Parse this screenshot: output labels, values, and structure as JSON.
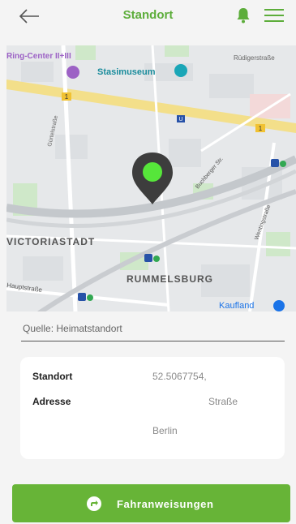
{
  "header": {
    "title": "Standort",
    "back_icon": "arrow-left-icon",
    "notification_icon": "bell-icon",
    "menu_icon": "hamburger-menu-icon",
    "accent_color": "#5cad3a"
  },
  "map": {
    "labels": {
      "ring_center": "Ring-Center II+III",
      "stasimuseum": "Stasimuseum",
      "ruedigerstrasse": "Rüdigerstraße",
      "guertelstrasse": "Gürtelstraße",
      "buchberger": "Buchberger Str.",
      "victoriastadt": "VICTORIASTADT",
      "rummelsburg": "RUMMELSBURG",
      "wentingstrasse": "Wentingstraße",
      "hauptstrasse": "Hauptstraße",
      "kaufland": "Kaufland",
      "road_badge_1": "1",
      "road_badge_2": "1",
      "ubahn": "U"
    },
    "marker_icon": "location-pin-icon",
    "marker_color": "#56e63a"
  },
  "source": {
    "label": "Quelle: Heimatstandort"
  },
  "details": {
    "standort_label": "Standort",
    "standort_value": "52.5067754,",
    "adresse_label": "Adresse",
    "adresse_value": "Straße",
    "city_value": "Berlin"
  },
  "cta": {
    "label": "Fahranweisungen",
    "icon": "directions-icon",
    "color": "#67b437"
  }
}
